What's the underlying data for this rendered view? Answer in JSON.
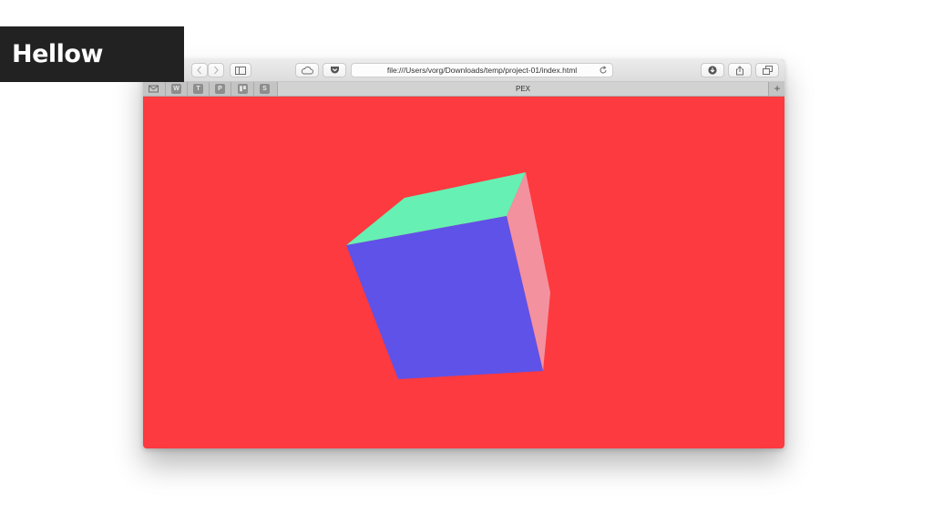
{
  "slide": {
    "title": "Hellow World"
  },
  "browser": {
    "url": "file:///Users/vorg/Downloads/temp/project-01/index.html",
    "favorites": [
      {
        "icon": "mail-icon",
        "letter": ""
      },
      {
        "icon": "w-favicon",
        "letter": "W"
      },
      {
        "icon": "t-favicon",
        "letter": "T"
      },
      {
        "icon": "p-favicon",
        "letter": "P"
      },
      {
        "icon": "trello-favicon",
        "letter": ""
      },
      {
        "icon": "s-favicon",
        "letter": "S"
      }
    ],
    "tab": {
      "title": "PEX"
    },
    "new_tab_label": "+",
    "toolbar_icons": [
      "back-icon",
      "forward-icon",
      "sidebar-icon",
      "icloud-icon",
      "pocket-icon",
      "reload-icon",
      "download-icon",
      "share-icon",
      "tabs-overview-icon"
    ]
  },
  "page": {
    "background_color": "#fc3a3f",
    "cube": {
      "top_face_color": "#66f0b3",
      "front_face_color": "#5f52e8",
      "side_face_color": "#f3919f"
    }
  }
}
